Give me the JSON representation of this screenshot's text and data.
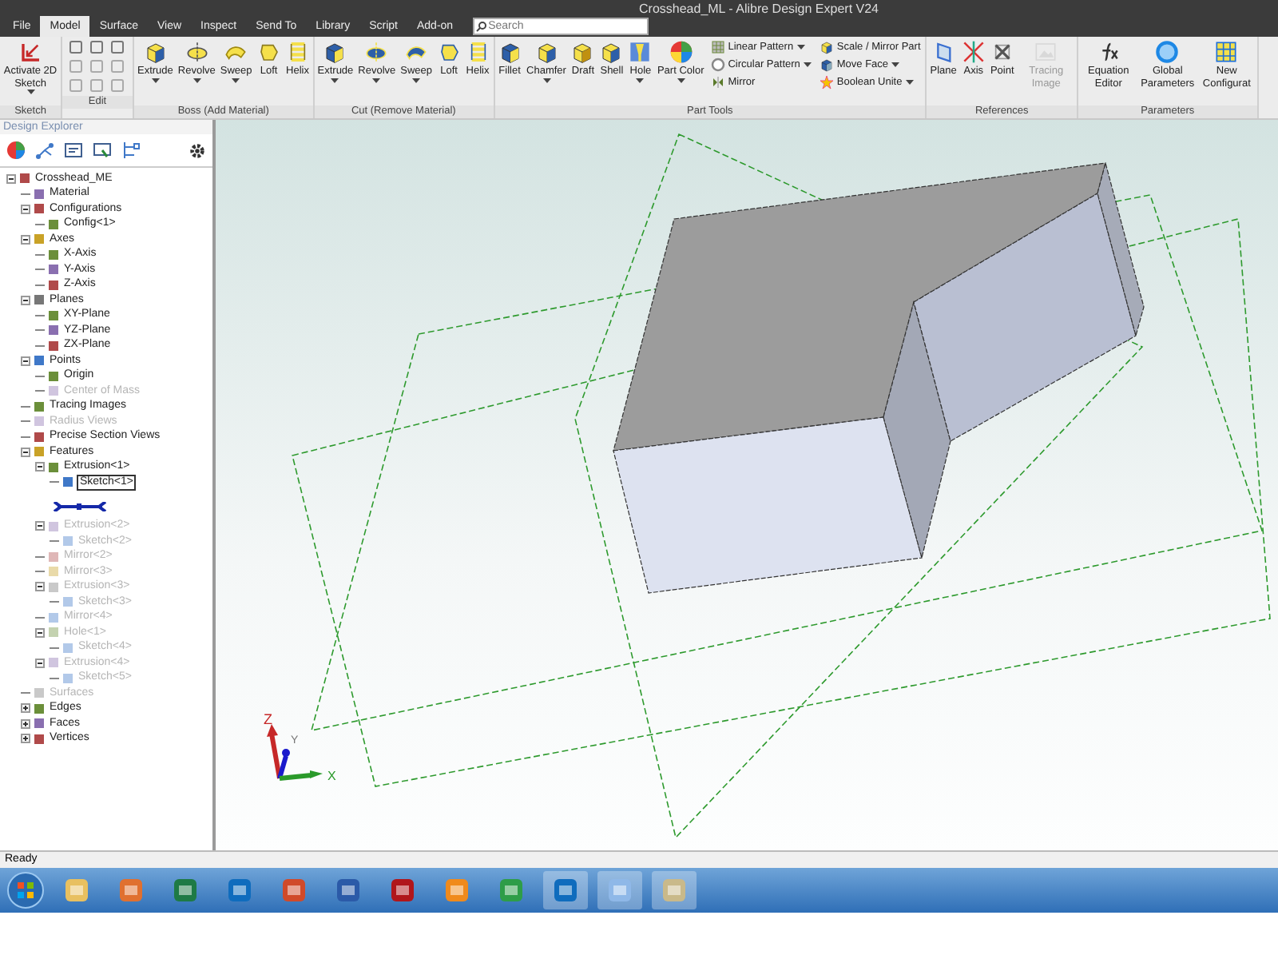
{
  "window": {
    "title": "Crosshead_ML - Alibre Design Expert V24"
  },
  "tabs": [
    {
      "label": "File",
      "selected": false
    },
    {
      "label": "Model",
      "selected": true
    },
    {
      "label": "Surface",
      "selected": false
    },
    {
      "label": "View",
      "selected": false
    },
    {
      "label": "Inspect",
      "selected": false
    },
    {
      "label": "Send To",
      "selected": false
    },
    {
      "label": "Library",
      "selected": false
    },
    {
      "label": "Script",
      "selected": false
    },
    {
      "label": "Add-on",
      "selected": false
    }
  ],
  "search": {
    "placeholder": "Search"
  },
  "ribbon": [
    {
      "label": "Sketch",
      "tools": [
        {
          "label": "Activate 2D Sketch",
          "kind": "large",
          "dropdown": true,
          "disabled": false
        }
      ]
    },
    {
      "label": "Edit"
    },
    {
      "label": "Boss (Add Material)",
      "tools": [
        {
          "label": "Extrude",
          "kind": "large",
          "dropdown": true,
          "disabled": false
        },
        {
          "label": "Revolve",
          "kind": "large",
          "dropdown": true,
          "disabled": false
        },
        {
          "label": "Sweep",
          "kind": "large",
          "dropdown": true,
          "disabled": false
        },
        {
          "label": "Loft",
          "kind": "large",
          "dropdown": false,
          "disabled": false
        },
        {
          "label": "Helix",
          "kind": "large",
          "dropdown": false,
          "disabled": false
        }
      ]
    },
    {
      "label": "Cut (Remove Material)",
      "tools": [
        {
          "label": "Extrude",
          "kind": "large",
          "dropdown": true,
          "disabled": false
        },
        {
          "label": "Revolve",
          "kind": "large",
          "dropdown": true,
          "disabled": false
        },
        {
          "label": "Sweep",
          "kind": "large",
          "dropdown": true,
          "disabled": false
        },
        {
          "label": "Loft",
          "kind": "large",
          "dropdown": false,
          "disabled": false
        },
        {
          "label": "Helix",
          "kind": "large",
          "dropdown": false,
          "disabled": false
        }
      ]
    },
    {
      "label": "Part Tools",
      "tools": [
        {
          "label": "Fillet",
          "kind": "large",
          "dropdown": false,
          "disabled": false
        },
        {
          "label": "Chamfer",
          "kind": "large",
          "dropdown": true,
          "disabled": false
        },
        {
          "label": "Draft",
          "kind": "large",
          "dropdown": false,
          "disabled": false
        },
        {
          "label": "Shell",
          "kind": "large",
          "dropdown": false,
          "disabled": false
        },
        {
          "label": "Hole",
          "kind": "large",
          "dropdown": true,
          "disabled": false
        },
        {
          "label": "Part Color",
          "kind": "large",
          "dropdown": true,
          "disabled": false
        },
        {
          "label": "Linear Pattern",
          "kind": "small",
          "dropdown": true,
          "disabled": false
        },
        {
          "label": "Circular Pattern",
          "kind": "small",
          "dropdown": true,
          "disabled": false
        },
        {
          "label": "Mirror",
          "kind": "small",
          "dropdown": false,
          "disabled": false
        },
        {
          "label": "Scale / Mirror Part",
          "kind": "small",
          "dropdown": false,
          "disabled": false
        },
        {
          "label": "Move Face",
          "kind": "small",
          "dropdown": true,
          "disabled": false
        },
        {
          "label": "Boolean Unite",
          "kind": "small",
          "dropdown": true,
          "disabled": false
        }
      ]
    },
    {
      "label": "References",
      "tools": [
        {
          "label": "Plane",
          "kind": "large",
          "dropdown": false,
          "disabled": false
        },
        {
          "label": "Axis",
          "kind": "large",
          "dropdown": false,
          "disabled": false
        },
        {
          "label": "Point",
          "kind": "large",
          "dropdown": false,
          "disabled": false
        },
        {
          "label": "Tracing Image",
          "kind": "large",
          "dropdown": false,
          "disabled": true
        }
      ]
    },
    {
      "label": "Parameters",
      "tools": [
        {
          "label": "Equation Editor",
          "kind": "large",
          "dropdown": false,
          "disabled": false
        },
        {
          "label": "Global Parameters",
          "kind": "large",
          "dropdown": false,
          "disabled": false
        },
        {
          "label": "New Configurat",
          "kind": "large",
          "dropdown": false,
          "disabled": false
        }
      ]
    }
  ],
  "explorer": {
    "title": "Design Explorer",
    "tree": [
      {
        "label": "Crosshead_ME",
        "disabled": false,
        "selected": false,
        "expanded": true,
        "children": [
          {
            "label": "Material",
            "disabled": false,
            "selected": false
          },
          {
            "label": "Configurations",
            "disabled": false,
            "selected": false,
            "expanded": true,
            "children": [
              {
                "label": "Config<1>",
                "disabled": false,
                "selected": false
              }
            ]
          },
          {
            "label": "Axes",
            "disabled": false,
            "selected": false,
            "expanded": true,
            "children": [
              {
                "label": "X-Axis",
                "disabled": false,
                "selected": false
              },
              {
                "label": "Y-Axis",
                "disabled": false,
                "selected": false
              },
              {
                "label": "Z-Axis",
                "disabled": false,
                "selected": false
              }
            ]
          },
          {
            "label": "Planes",
            "disabled": false,
            "selected": false,
            "expanded": true,
            "children": [
              {
                "label": "XY-Plane",
                "disabled": false,
                "selected": false
              },
              {
                "label": "YZ-Plane",
                "disabled": false,
                "selected": false
              },
              {
                "label": "ZX-Plane",
                "disabled": false,
                "selected": false
              }
            ]
          },
          {
            "label": "Points",
            "disabled": false,
            "selected": false,
            "expanded": true,
            "children": [
              {
                "label": "Origin",
                "disabled": false,
                "selected": false
              },
              {
                "label": "Center of Mass",
                "disabled": true,
                "selected": false
              }
            ]
          },
          {
            "label": "Tracing Images",
            "disabled": false,
            "selected": false
          },
          {
            "label": "Radius Views",
            "disabled": true,
            "selected": false
          },
          {
            "label": "Precise Section Views",
            "disabled": false,
            "selected": false
          },
          {
            "label": "Features",
            "disabled": false,
            "selected": false,
            "expanded": true,
            "children": [
              {
                "label": "Extrusion<1>",
                "disabled": false,
                "selected": false,
                "expanded": true,
                "children": [
                  {
                    "label": "Sketch<1>",
                    "disabled": false,
                    "selected": true
                  }
                ]
              },
              {
                "label": "Extrusion<2>",
                "disabled": true,
                "selected": false,
                "expanded": true,
                "children": [
                  {
                    "label": "Sketch<2>",
                    "disabled": true,
                    "selected": false
                  }
                ]
              },
              {
                "label": "Mirror<2>",
                "disabled": true,
                "selected": false
              },
              {
                "label": "Mirror<3>",
                "disabled": true,
                "selected": false
              },
              {
                "label": "Extrusion<3>",
                "disabled": true,
                "selected": false,
                "expanded": true,
                "children": [
                  {
                    "label": "Sketch<3>",
                    "disabled": true,
                    "selected": false
                  }
                ]
              },
              {
                "label": "Mirror<4>",
                "disabled": true,
                "selected": false
              },
              {
                "label": "Hole<1>",
                "disabled": true,
                "selected": false,
                "expanded": true,
                "children": [
                  {
                    "label": "Sketch<4>",
                    "disabled": true,
                    "selected": false
                  }
                ]
              },
              {
                "label": "Extrusion<4>",
                "disabled": true,
                "selected": false,
                "expanded": true,
                "children": [
                  {
                    "label": "Sketch<5>",
                    "disabled": true,
                    "selected": false
                  }
                ]
              }
            ]
          },
          {
            "label": "Surfaces",
            "disabled": true,
            "selected": false
          },
          {
            "label": "Edges",
            "disabled": false,
            "selected": false,
            "expanded": false
          },
          {
            "label": "Faces",
            "disabled": false,
            "selected": false,
            "expanded": false
          },
          {
            "label": "Vertices",
            "disabled": false,
            "selected": false,
            "expanded": false
          }
        ]
      }
    ]
  },
  "triad": [
    "Z",
    "Y",
    "X"
  ],
  "status_bar": "Ready"
}
